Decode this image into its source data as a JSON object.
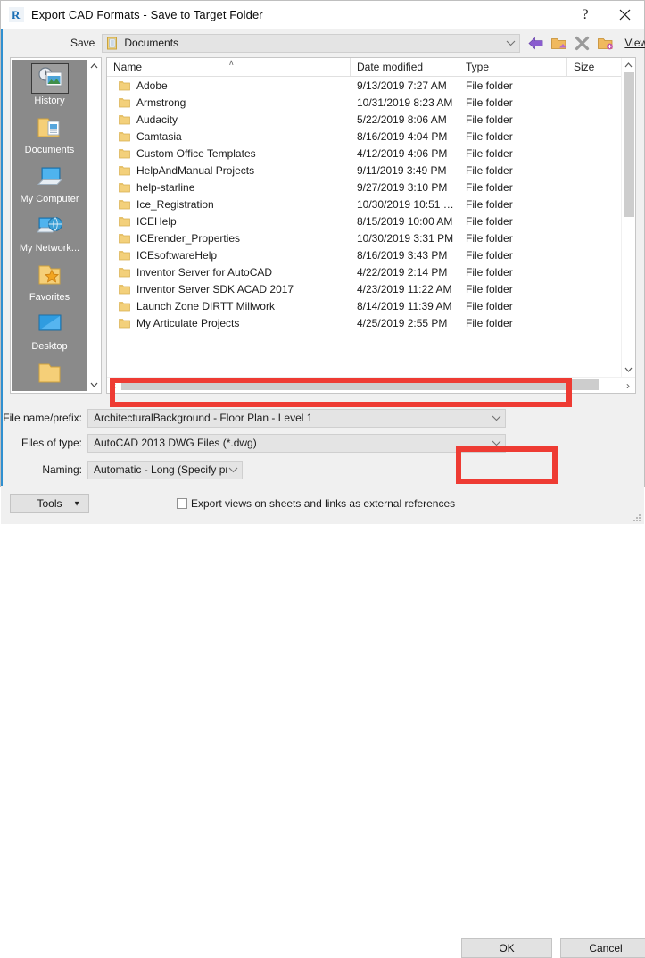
{
  "window": {
    "title": "Export CAD Formats - Save to Target Folder",
    "app_icon": "revit-r-logo",
    "help_label": "?",
    "close_label": "✕",
    "accent_color": "#2f8fd0",
    "highlight_color": "#ee3b33"
  },
  "savebar": {
    "label": "Save",
    "path_icon": "documents-folder-icon",
    "path_value": "Documents",
    "toolbar_icons": [
      "back-arrow-icon",
      "up-one-level-icon",
      "delete-icon",
      "new-folder-icon"
    ],
    "views_label": "Views",
    "views_caret": "▾"
  },
  "places": {
    "items": [
      {
        "label": "History",
        "icon": "history-icon",
        "selected": true
      },
      {
        "label": "Documents",
        "icon": "documents-icon",
        "selected": false
      },
      {
        "label": "My Computer",
        "icon": "computer-icon",
        "selected": false
      },
      {
        "label": "My Network...",
        "icon": "network-icon",
        "selected": false
      },
      {
        "label": "Favorites",
        "icon": "favorites-icon",
        "selected": false
      },
      {
        "label": "Desktop",
        "icon": "desktop-icon",
        "selected": false
      }
    ],
    "scroll_up": "∧",
    "scroll_down": "∨"
  },
  "filelist": {
    "columns": [
      "Name",
      "Date modified",
      "Type",
      "Size"
    ],
    "sort_indicator": "∧",
    "sorted_column": "Name",
    "rows": [
      {
        "name": "Adobe",
        "date": "9/13/2019 7:27 AM",
        "type": "File folder",
        "size": ""
      },
      {
        "name": "Armstrong",
        "date": "10/31/2019 8:23 AM",
        "type": "File folder",
        "size": ""
      },
      {
        "name": "Audacity",
        "date": "5/22/2019 8:06 AM",
        "type": "File folder",
        "size": ""
      },
      {
        "name": "Camtasia",
        "date": "8/16/2019 4:04 PM",
        "type": "File folder",
        "size": ""
      },
      {
        "name": "Custom Office Templates",
        "date": "4/12/2019 4:06 PM",
        "type": "File folder",
        "size": ""
      },
      {
        "name": "HelpAndManual Projects",
        "date": "9/11/2019 3:49 PM",
        "type": "File folder",
        "size": ""
      },
      {
        "name": "help-starline",
        "date": "9/27/2019 3:10 PM",
        "type": "File folder",
        "size": ""
      },
      {
        "name": "Ice_Registration",
        "date": "10/30/2019 10:51 …",
        "type": "File folder",
        "size": ""
      },
      {
        "name": "ICEHelp",
        "date": "8/15/2019 10:00 AM",
        "type": "File folder",
        "size": ""
      },
      {
        "name": "ICErender_Properties",
        "date": "10/30/2019 3:31 PM",
        "type": "File folder",
        "size": ""
      },
      {
        "name": "ICEsoftwareHelp",
        "date": "8/16/2019 3:43 PM",
        "type": "File folder",
        "size": ""
      },
      {
        "name": "Inventor Server for AutoCAD",
        "date": "4/22/2019 2:14 PM",
        "type": "File folder",
        "size": ""
      },
      {
        "name": "Inventor Server SDK ACAD 2017",
        "date": "4/23/2019 11:22 AM",
        "type": "File folder",
        "size": ""
      },
      {
        "name": "Launch Zone DIRTT Millwork",
        "date": "8/14/2019 11:39 AM",
        "type": "File folder",
        "size": ""
      },
      {
        "name": "My Articulate Projects",
        "date": "4/25/2019 2:55 PM",
        "type": "File folder",
        "size": ""
      }
    ],
    "hscroll_left": "‹",
    "hscroll_right": "›",
    "vscroll_up": "∧",
    "vscroll_down": "∨"
  },
  "form": {
    "filename_label": "File name/prefix:",
    "filename_value": "ArchitecturalBackground - Floor Plan - Level 1",
    "filetype_label": "Files of type:",
    "filetype_value": "AutoCAD 2013 DWG Files  (*.dwg)",
    "naming_label": "Naming:",
    "naming_value": "Automatic - Long (Specify prefix)",
    "caret": "∨"
  },
  "footer": {
    "tools_label": "Tools",
    "tools_caret": "▼",
    "export_checkbox_label": "Export views on sheets and links as external references",
    "export_checkbox_checked": false,
    "ok_label": "OK",
    "cancel_label": "Cancel"
  }
}
